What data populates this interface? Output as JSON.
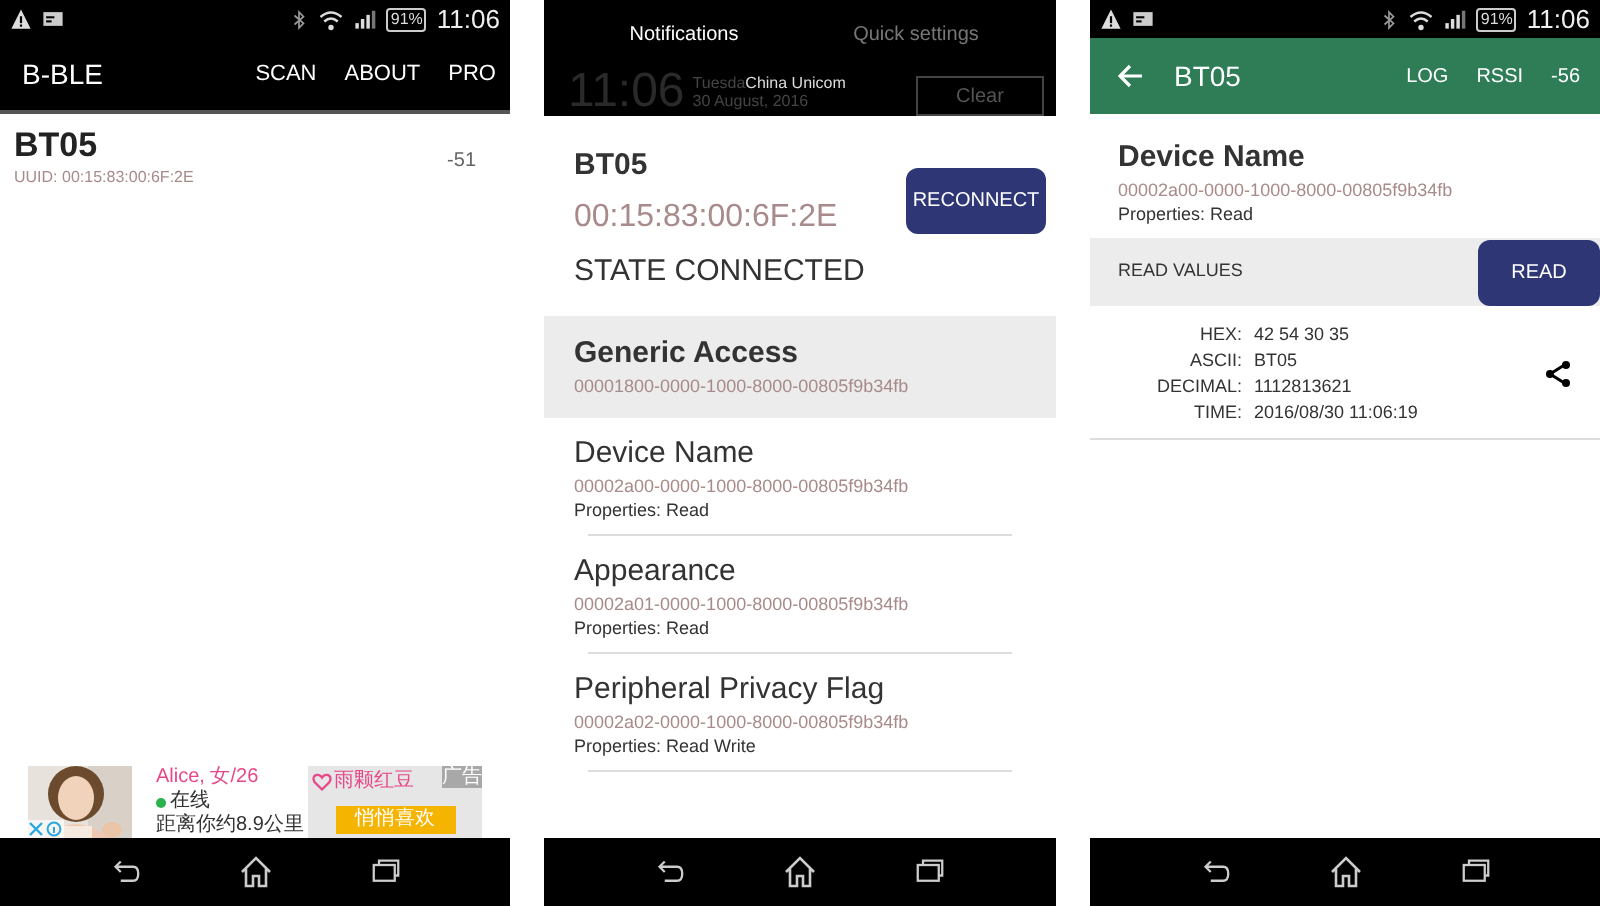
{
  "scan_screen": {
    "status_bar": {
      "battery": "91%",
      "time": "11:06"
    },
    "app_bar": {
      "title": "B-BLE",
      "actions": [
        "SCAN",
        "ABOUT",
        "PRO"
      ]
    },
    "devices": [
      {
        "name": "BT05",
        "uuid": "UUID: 00:15:83:00:6F:2E",
        "rssi": "-51"
      }
    ],
    "ad": {
      "name": "Alice, 女/26",
      "status": "在线",
      "distance": "距离你约8.9公里",
      "brand": "雨颗红豆",
      "label": "广告",
      "cta": "悄悄喜欢"
    }
  },
  "device_screen": {
    "notification_shade": {
      "tabs": [
        {
          "label": "Notifications",
          "selected": true
        },
        {
          "label": "Quick settings",
          "selected": false
        }
      ],
      "clock": "11:06",
      "day": "Tuesda",
      "carrier": "China Unicom",
      "date": "30 August, 2016",
      "clear_button": "Clear"
    },
    "device": {
      "name": "BT05",
      "address": "00:15:83:00:6F:2E",
      "state": "STATE CONNECTED",
      "reconnect_button": "RECONNECT"
    },
    "services": [
      {
        "name": "Generic Access",
        "uuid": "00001800-0000-1000-8000-00805f9b34fb",
        "selected": true
      }
    ],
    "characteristics": [
      {
        "name": "Device Name",
        "uuid": "00002a00-0000-1000-8000-00805f9b34fb",
        "properties": "Properties: Read"
      },
      {
        "name": "Appearance",
        "uuid": "00002a01-0000-1000-8000-00805f9b34fb",
        "properties": "Properties: Read"
      },
      {
        "name": "Peripheral Privacy Flag",
        "uuid": "00002a02-0000-1000-8000-00805f9b34fb",
        "properties": "Properties: Read Write"
      }
    ]
  },
  "characteristic_screen": {
    "status_bar": {
      "battery": "91%",
      "time": "11:06"
    },
    "app_bar": {
      "title": "BT05",
      "actions": [
        "LOG",
        "RSSI",
        "-56"
      ]
    },
    "characteristic": {
      "name": "Device Name",
      "uuid": "00002a00-0000-1000-8000-00805f9b34fb",
      "properties": "Properties: Read"
    },
    "read_bar": {
      "label": "READ VALUES",
      "button": "READ"
    },
    "values": [
      {
        "label": "HEX:",
        "value": "42 54 30 35"
      },
      {
        "label": "ASCII:",
        "value": "BT05"
      },
      {
        "label": "DECIMAL:",
        "value": "1112813621"
      },
      {
        "label": "TIME:",
        "value": "2016/08/30 11:06:19"
      }
    ]
  }
}
